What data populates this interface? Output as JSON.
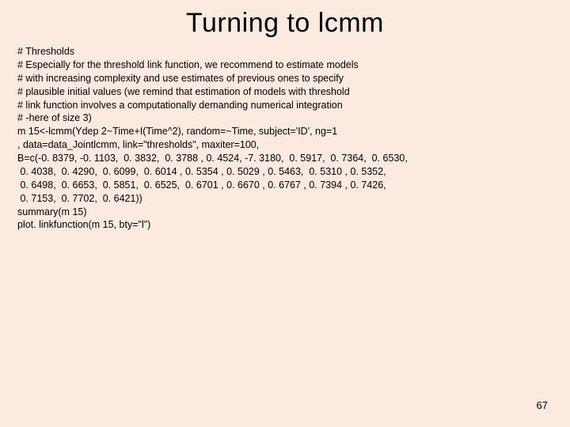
{
  "title": "Turning to lcmm",
  "body_lines": [
    "# Thresholds",
    "# Especially for the threshold link function, we recommend to estimate models",
    "# with increasing complexity and use estimates of previous ones to specify",
    "# plausible initial values (we remind that estimation of models with threshold",
    "# link function involves a computationally demanding numerical integration",
    "# -here of size 3)",
    "m 15<-lcmm(Ydep 2~Time+I(Time^2), random=~Time, subject='ID', ng=1",
    ", data=data_Jointlcmm, link=\"thresholds\", maxiter=100,",
    "B=c(-0. 8379, -0. 1103,  0. 3832,  0. 3788 , 0. 4524, -7. 3180,  0. 5917,  0. 7364,  0. 6530,",
    " 0. 4038,  0. 4290,  0. 6099,  0. 6014 , 0. 5354 , 0. 5029 , 0. 5463,  0. 5310 , 0. 5352,",
    " 0. 6498,  0. 6653,  0. 5851,  0. 6525,  0. 6701 , 0. 6670 , 0. 6767 , 0. 7394 , 0. 7426,",
    " 0. 7153,  0. 7702,  0. 6421))",
    "summary(m 15)",
    "plot. linkfunction(m 15, bty=\"l\")"
  ],
  "page_number": "67"
}
